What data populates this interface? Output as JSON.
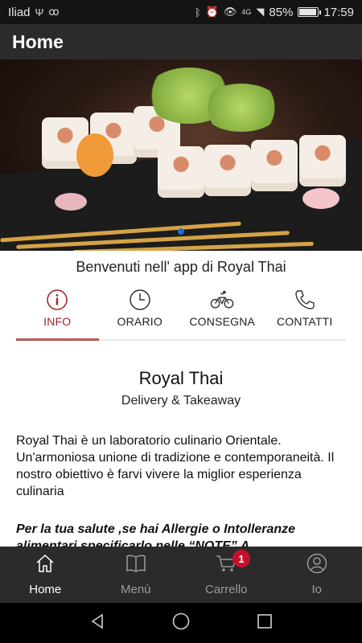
{
  "status_bar": {
    "carrier": "Iliad",
    "network": "4G",
    "battery": "85%",
    "battery_level": 0.85,
    "time": "17:59"
  },
  "app_bar": {
    "title": "Home"
  },
  "welcome": "Benvenuti nell' app di Royal Thai",
  "tabs": [
    {
      "label": "INFO",
      "icon": "info-icon",
      "active": true
    },
    {
      "label": "ORARIO",
      "icon": "clock-icon",
      "active": false
    },
    {
      "label": "CONSEGNA",
      "icon": "bicycle-icon",
      "active": false
    },
    {
      "label": "CONTATTI",
      "icon": "phone-icon",
      "active": false
    }
  ],
  "info": {
    "name": "Royal Thai",
    "subtitle": "Delivery & Takeaway",
    "description": "Royal Thai è un laboratorio culinario Orientale. Un'armoniosa unione di tradizione e contemporaneità. Il nostro obiettivo è farvi vivere la miglior esperienza culinaria",
    "note": "Per la tua salute ,se hai Allergie o Intolleranze alimentari specificarlo nelle “NOTE” A"
  },
  "bottom_nav": [
    {
      "label": "Home",
      "icon": "home-icon",
      "active": true
    },
    {
      "label": "Menù",
      "icon": "book-icon",
      "active": false
    },
    {
      "label": "Carrello",
      "icon": "cart-icon",
      "active": false,
      "badge": "1"
    },
    {
      "label": "Io",
      "icon": "user-icon",
      "active": false
    }
  ],
  "colors": {
    "accent": "#a3262b",
    "app_bar": "#2b2b2b",
    "badge": "#c8102e",
    "carousel_dot": "#1e6fd9"
  }
}
